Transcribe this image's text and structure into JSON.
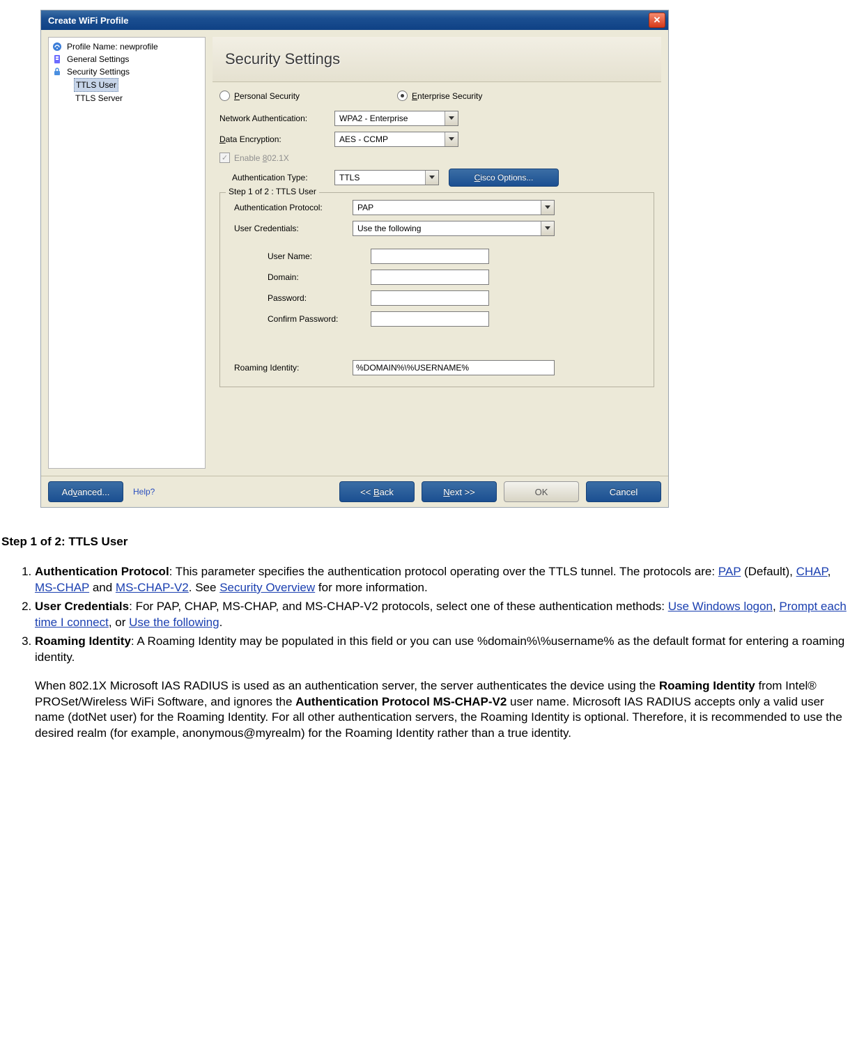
{
  "window": {
    "title": "Create WiFi Profile"
  },
  "sidebar": {
    "items": [
      {
        "label": "Profile Name: newprofile",
        "icon": "wifi-icon"
      },
      {
        "label": "General Settings",
        "icon": "settings-icon"
      },
      {
        "label": "Security Settings",
        "icon": "lock-icon"
      },
      {
        "label": "TTLS User",
        "indent": true,
        "selected": true
      },
      {
        "label": "TTLS Server",
        "indent": true
      }
    ]
  },
  "main": {
    "header": "Security Settings",
    "radios": {
      "personal": "Personal Security",
      "enterprise": "Enterprise Security"
    },
    "net_auth_label": "Network Authentication:",
    "net_auth_value": "WPA2 - Enterprise",
    "data_enc_label": "Data Encryption:",
    "data_enc_value": "AES - CCMP",
    "enable_8021x": "Enable 802.1X",
    "auth_type_label": "Authentication Type:",
    "auth_type_value": "TTLS",
    "cisco_btn": "Cisco Options...",
    "step_legend": "Step 1 of 2 : TTLS User",
    "auth_proto_label": "Authentication Protocol:",
    "auth_proto_value": "PAP",
    "user_cred_label": "User Credentials:",
    "user_cred_value": "Use the following",
    "username_label": "User Name:",
    "domain_label": "Domain:",
    "password_label": "Password:",
    "confirm_label": "Confirm Password:",
    "roaming_label": "Roaming Identity:",
    "roaming_value": "%DOMAIN%\\%USERNAME%"
  },
  "footer": {
    "advanced": "Advanced...",
    "help": "Help?",
    "back": "<< Back",
    "next": "Next >>",
    "ok": "OK",
    "cancel": "Cancel"
  },
  "doc": {
    "heading": "Step 1 of 2: TTLS User",
    "item1": {
      "term": "Authentication Protocol",
      "p1": ": This parameter specifies the authentication protocol operating over the TTLS tunnel. The protocols are: ",
      "pap": "PAP",
      "p2": " (Default), ",
      "chap": "CHAP",
      "p3": ", ",
      "mschap": "MS-CHAP",
      "p4": " and ",
      "mschapv2": "MS-CHAP-V2",
      "p5": ". See ",
      "seclink": "Security Overview",
      "p6": " for more information."
    },
    "item2": {
      "term": "User Credentials",
      "p1": ": For PAP, CHAP, MS-CHAP, and MS-CHAP-V2 protocols, select one of these authentication methods: ",
      "l1": "Use Windows logon",
      "p2": ", ",
      "l2": "Prompt each time I connect",
      "p3": ", or ",
      "l3": "Use the following",
      "p4": "."
    },
    "item3": {
      "term": "Roaming Identity",
      "p1": ": A Roaming Identity may be populated in this field or you can use %domain%\\%username% as the default format for entering a roaming identity.",
      "para_a": "When 802.1X Microsoft IAS RADIUS is used as an authentication server, the server authenticates the device using the ",
      "bold1": "Roaming Identity",
      "para_b": " from Intel® PROSet/Wireless WiFi Software, and ignores the ",
      "bold2": "Authentication Protocol MS-CHAP-V2",
      "para_c": " user name. Microsoft IAS RADIUS accepts only a valid user name (dotNet user) for the Roaming Identity. For all other authentication servers, the Roaming Identity is optional. Therefore, it is recommended to use the desired realm (for example, anonymous@myrealm) for the Roaming Identity rather than a true identity."
    }
  }
}
